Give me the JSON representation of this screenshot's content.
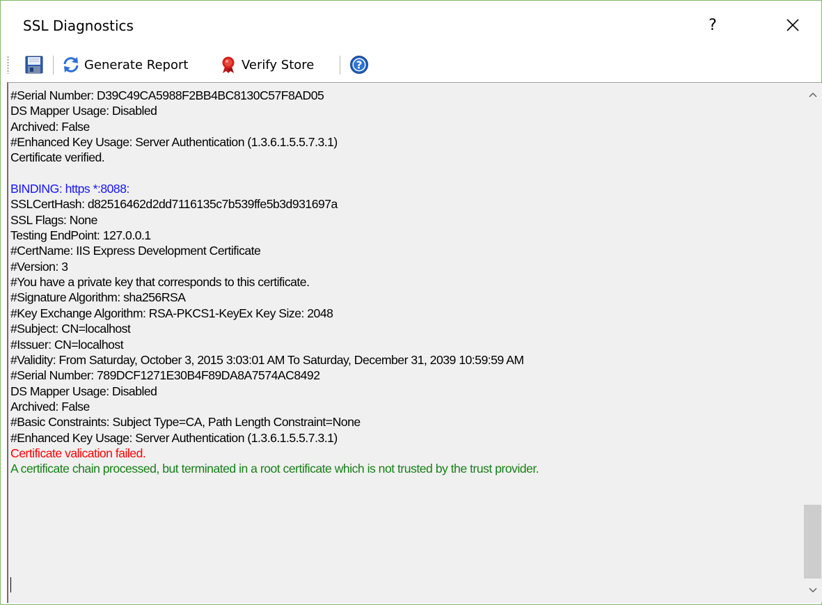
{
  "window": {
    "title": "SSL Diagnostics",
    "help_label": "?",
    "close_icon": "close-icon"
  },
  "toolbar": {
    "save_icon": "save-icon",
    "generate_report_label": "Generate Report",
    "generate_report_icon": "refresh-icon",
    "verify_store_label": "Verify Store",
    "verify_store_icon": "certificate-seal-icon",
    "help_icon": "help-icon"
  },
  "colors": {
    "binding": "#1515ff",
    "error": "#ff0000",
    "info": "#168016",
    "background": "#f0f0f0"
  },
  "output": {
    "lines": [
      {
        "text": "#Serial Number: D39C49CA5988F2BB4BC8130C57F8AD05",
        "style": "normal"
      },
      {
        "text": "DS Mapper Usage: Disabled",
        "style": "normal"
      },
      {
        "text": "Archived: False",
        "style": "normal"
      },
      {
        "text": "#Enhanced Key Usage: Server Authentication (1.3.6.1.5.5.7.3.1)",
        "style": "normal"
      },
      {
        "text": "Certificate verified.",
        "style": "normal"
      },
      {
        "text": "",
        "style": "normal"
      },
      {
        "text": "BINDING: https *:8088:",
        "style": "blue"
      },
      {
        "text": "SSLCertHash: d82516462d2dd7116135c7b539ffe5b3d931697a",
        "style": "normal"
      },
      {
        "text": "SSL Flags: None",
        "style": "normal"
      },
      {
        "text": "Testing EndPoint: 127.0.0.1",
        "style": "normal"
      },
      {
        "text": "#CertName: IIS Express Development Certificate",
        "style": "normal"
      },
      {
        "text": "#Version: 3",
        "style": "normal"
      },
      {
        "text": "#You have a private key that corresponds to this certificate.",
        "style": "normal"
      },
      {
        "text": "#Signature Algorithm: sha256RSA",
        "style": "normal"
      },
      {
        "text": "#Key Exchange Algorithm: RSA-PKCS1-KeyEx Key Size: 2048",
        "style": "normal"
      },
      {
        "text": "#Subject: CN=localhost",
        "style": "normal"
      },
      {
        "text": "#Issuer: CN=localhost",
        "style": "normal"
      },
      {
        "text": "#Validity: From Saturday, October 3, 2015 3:03:01 AM To Saturday, December 31, 2039 10:59:59 AM",
        "style": "normal"
      },
      {
        "text": "#Serial Number: 789DCF1271E30B4F89DA8A7574AC8492",
        "style": "normal"
      },
      {
        "text": "DS Mapper Usage: Disabled",
        "style": "normal"
      },
      {
        "text": "Archived: False",
        "style": "normal"
      },
      {
        "text": "#Basic Constraints: Subject Type=CA, Path Length Constraint=None",
        "style": "normal"
      },
      {
        "text": "#Enhanced Key Usage: Server Authentication (1.3.6.1.5.5.7.3.1)",
        "style": "normal"
      },
      {
        "text": "Certificate valication failed.",
        "style": "red"
      },
      {
        "text": "A certificate chain processed, but terminated in a root certificate which is not trusted by the trust provider.",
        "style": "green"
      }
    ]
  }
}
